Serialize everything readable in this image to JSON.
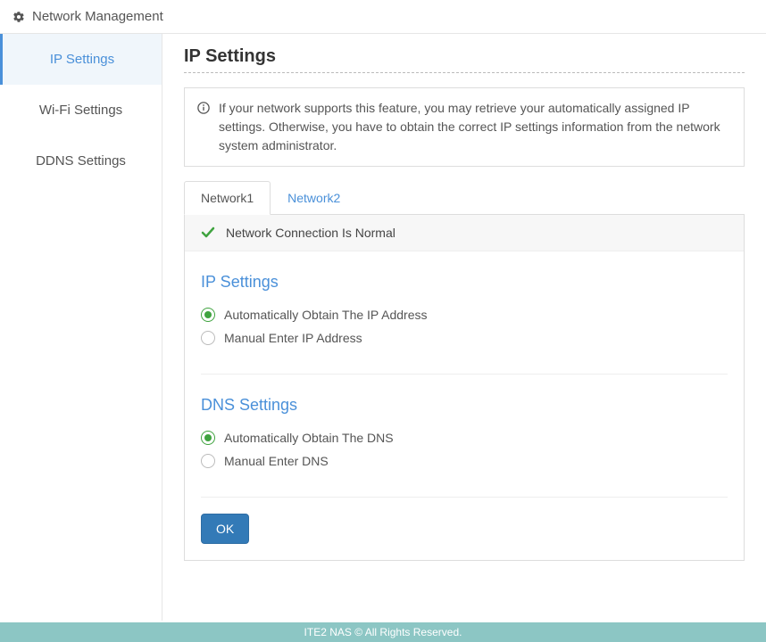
{
  "header": {
    "title": "Network Management"
  },
  "sidebar": {
    "items": [
      {
        "label": "IP Settings",
        "active": true
      },
      {
        "label": "Wi-Fi Settings",
        "active": false
      },
      {
        "label": "DDNS Settings",
        "active": false
      }
    ]
  },
  "page": {
    "title": "IP Settings"
  },
  "info": {
    "text": "If your network supports this feature, you may retrieve your automatically assigned IP settings. Otherwise, you have to obtain the correct IP settings information from the network system administrator."
  },
  "tabs": [
    {
      "label": "Network1",
      "active": true
    },
    {
      "label": "Network2",
      "active": false
    }
  ],
  "status": {
    "text": "Network Connection Is Normal"
  },
  "ip_section": {
    "title": "IP Settings",
    "options": [
      {
        "label": "Automatically Obtain The IP Address",
        "checked": true
      },
      {
        "label": "Manual Enter IP Address",
        "checked": false
      }
    ]
  },
  "dns_section": {
    "title": "DNS Settings",
    "options": [
      {
        "label": "Automatically Obtain The DNS",
        "checked": true
      },
      {
        "label": "Manual Enter DNS",
        "checked": false
      }
    ]
  },
  "buttons": {
    "ok": "OK"
  },
  "footer": {
    "text": "ITE2 NAS © All Rights Reserved."
  }
}
